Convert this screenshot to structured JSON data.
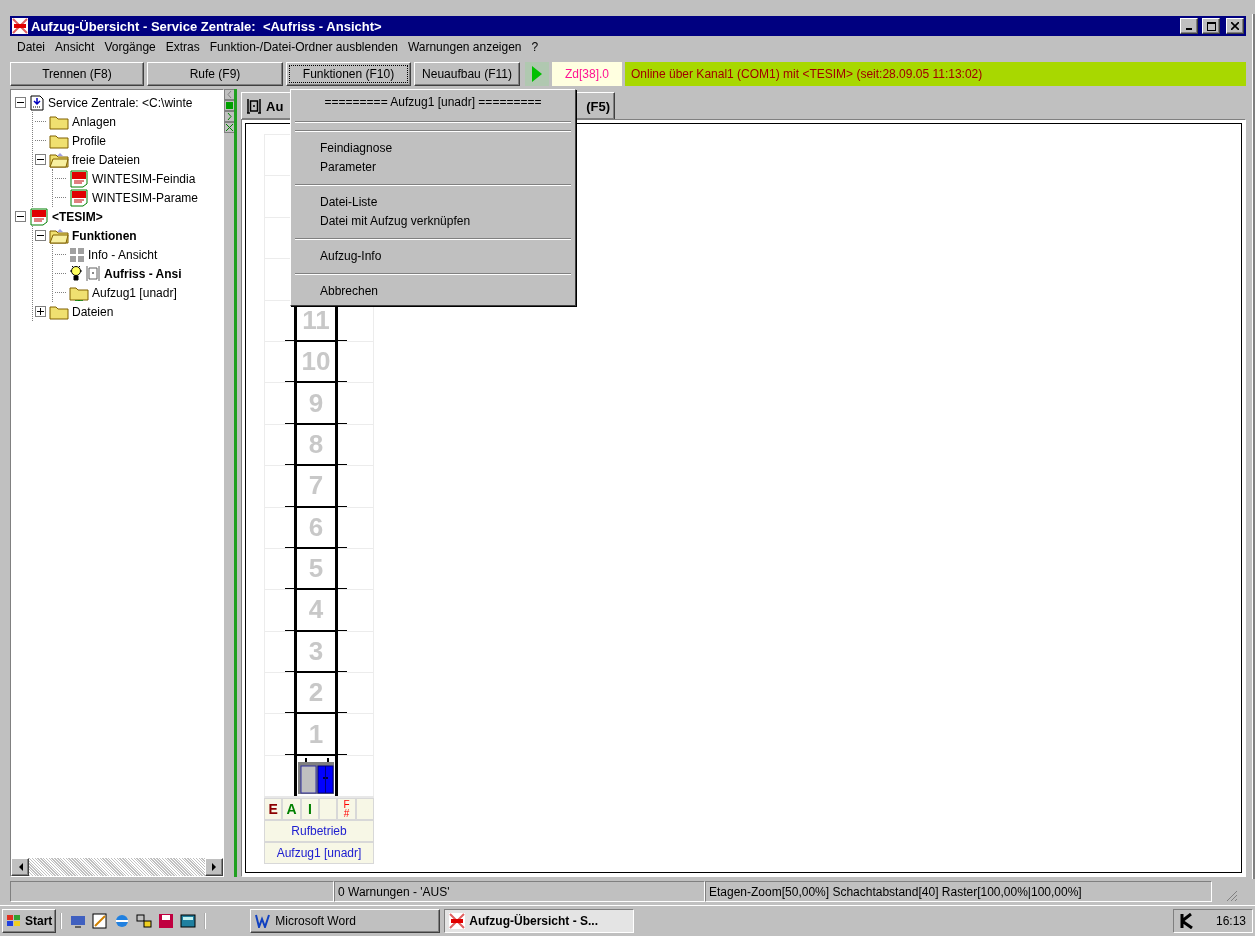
{
  "window": {
    "title": "Aufzug-Übersicht - Service Zentrale:  <Aufriss - Ansicht>"
  },
  "menu_bar": [
    "Datei",
    "Ansicht",
    "Vorgänge",
    "Extras",
    "Funktion-/Datei-Ordner ausblenden",
    "Warnungen anzeigen",
    "?"
  ],
  "toolbar": {
    "buttons": [
      {
        "label": "Trennen (F8)",
        "focused": false
      },
      {
        "label": "Rufe (F9)",
        "focused": false
      },
      {
        "label": "Funktionen (F10)",
        "focused": true
      },
      {
        "label": "Neuaufbau (F11)",
        "focused": false
      }
    ],
    "counter": "Zd[38].0",
    "connection": "Online über Kanal1 (COM1) mit <TESIM> (seit:28.09.05 11:13:02)"
  },
  "tree": [
    {
      "label": "Service Zentrale: <C:\\winte",
      "kind": "document",
      "bold": false,
      "expanded": true,
      "children": [
        {
          "label": "Anlagen",
          "kind": "folder",
          "bold": false
        },
        {
          "label": "Profile",
          "kind": "folder",
          "bold": false
        },
        {
          "label": "freie Dateien",
          "kind": "open-folder",
          "bold": false,
          "expanded": true,
          "children": [
            {
              "label": "WINTESIM-Feindia",
              "kind": "red-file",
              "bold": false
            },
            {
              "label": "WINTESIM-Parame",
              "kind": "red-file",
              "bold": false
            }
          ]
        }
      ]
    },
    {
      "label": "<TESIM>",
      "kind": "red-file",
      "bold": true,
      "expanded": true,
      "children": [
        {
          "label": "Funktionen",
          "kind": "open-folder",
          "bold": true,
          "expanded": true,
          "children": [
            {
              "label": "Info - Ansicht",
              "kind": "grid",
              "bold": false
            },
            {
              "label": "Aufriss - Ansi",
              "kind": "elevator",
              "bold": true
            },
            {
              "label": "Aufzug1 [unadr]",
              "kind": "network-folder",
              "bold": false
            }
          ]
        },
        {
          "label": "Dateien",
          "kind": "folder",
          "bold": false,
          "expanded": false
        }
      ]
    }
  ],
  "tab": {
    "label": "Au",
    "shortcut": "(F5)"
  },
  "context_menu": [
    {
      "kind": "header",
      "label": "========= Aufzug1 [unadr] ========="
    },
    {
      "kind": "separator"
    },
    {
      "kind": "separator"
    },
    {
      "kind": "item",
      "label": "Feindiagnose"
    },
    {
      "kind": "item",
      "label": "Parameter"
    },
    {
      "kind": "separator"
    },
    {
      "kind": "item",
      "label": "Datei-Liste"
    },
    {
      "kind": "item",
      "label": "Datei mit Aufzug verknüpfen"
    },
    {
      "kind": "separator"
    },
    {
      "kind": "item",
      "label": "Aufzug-Info"
    },
    {
      "kind": "separator"
    },
    {
      "kind": "item",
      "label": "Abbrechen"
    }
  ],
  "shaft": {
    "floors": [
      "11",
      "10",
      "9",
      "8",
      "7",
      "6",
      "5",
      "4",
      "3",
      "2",
      "1"
    ],
    "indicators": [
      {
        "kind": "letter",
        "label": "E",
        "color": "#8b0000"
      },
      {
        "kind": "letter",
        "label": "A",
        "color": "#008000"
      },
      {
        "kind": "letter",
        "label": "I",
        "color": "#008000"
      },
      {
        "kind": "blank"
      },
      {
        "kind": "stacked",
        "label": "F",
        "sub": "#",
        "color": "#ff0000"
      },
      {
        "kind": "blank"
      }
    ],
    "mode": "Rufbetrieb",
    "name": "Aufzug1 [unadr]"
  },
  "status_bar": [
    "0 Warnungen - 'AUS'",
    "Etagen-Zoom[50,00%] Schachtabstand[40] Raster[100,00%|100,00%]"
  ],
  "taskbar": {
    "start": "Start",
    "tasks": [
      {
        "kind": "word",
        "label": "Microsoft Word",
        "selected": false
      },
      {
        "kind": "app",
        "label": "Aufzug-Übersicht - S...",
        "selected": true
      }
    ],
    "clock": "16:13"
  }
}
